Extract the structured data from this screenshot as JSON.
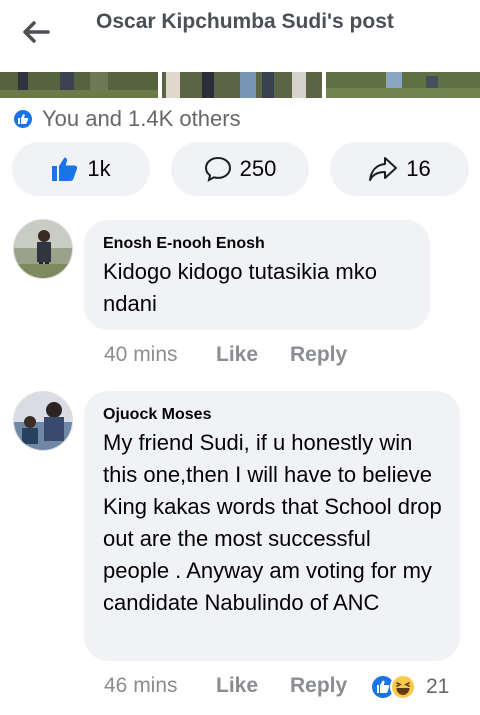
{
  "header": {
    "title": "Oscar Kipchumba Sudi's post"
  },
  "post": {
    "reactions_text": "You and 1.4K others",
    "actions": [
      {
        "name": "like",
        "icon": "thumbs-up-icon",
        "count": "1k",
        "color": "#1b74e4"
      },
      {
        "name": "comment",
        "icon": "comment-icon",
        "count": "250"
      },
      {
        "name": "share",
        "icon": "share-icon",
        "count": "16"
      }
    ]
  },
  "comments": [
    {
      "author": "Enosh E-nooh Enosh",
      "text": "Kidogo kidogo tutasikia mko ndani",
      "time": "40 mins",
      "like_label": "Like",
      "reply_label": "Reply"
    },
    {
      "author": "Ojuock Moses",
      "text": "My friend Sudi, if u honestly win this one,then I will have to believe King kakas words that School drop out are the most successful people . Anyway am voting for my candidate Nabulindo of ANC",
      "time": "46 mins",
      "like_label": "Like",
      "reply_label": "Reply",
      "reaction_icons": [
        "like-icon",
        "haha-icon"
      ],
      "reaction_count": "21"
    }
  ]
}
